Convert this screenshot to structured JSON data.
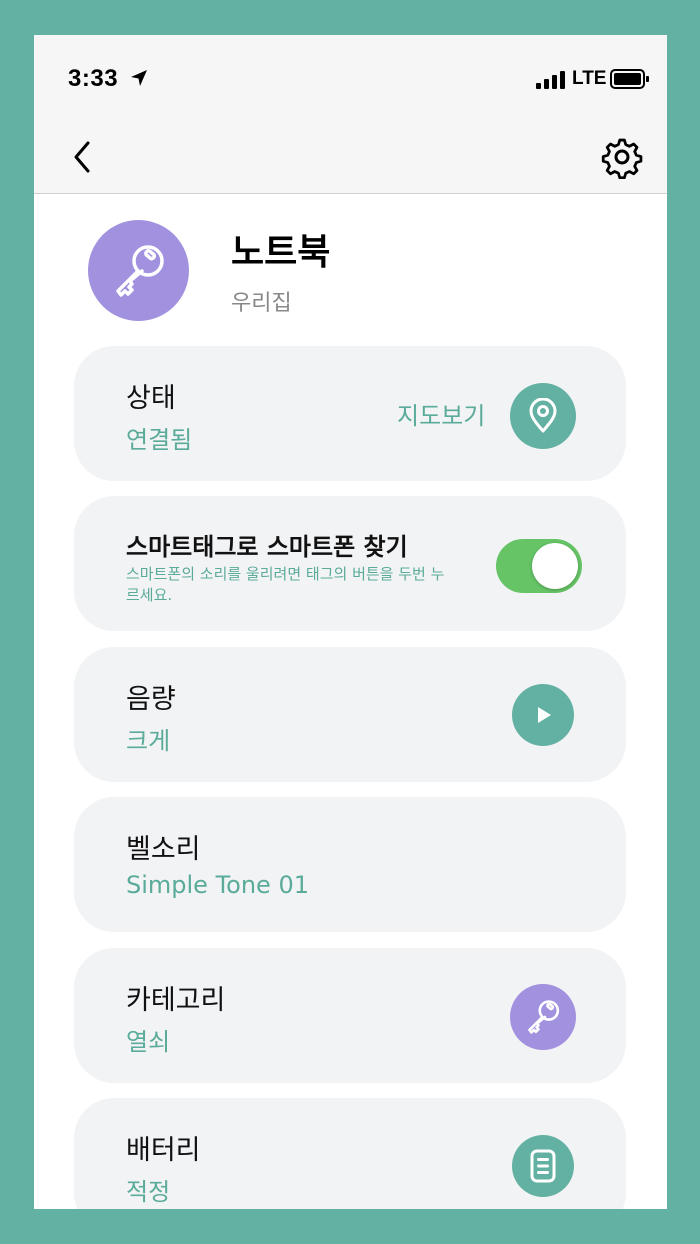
{
  "status": {
    "time": "3:33",
    "network": "LTE"
  },
  "device": {
    "name": "노트북",
    "location": "우리집"
  },
  "cards": {
    "state": {
      "title": "상태",
      "value": "연결됨",
      "map_label": "지도보기"
    },
    "find_phone": {
      "title": "스마트태그로 스마트폰 찾기",
      "description": "스마트폰의 소리를 울리려면 태그의 버튼을 두번 누르세요.",
      "enabled": true
    },
    "volume": {
      "title": "음량",
      "value": "크게"
    },
    "ringtone": {
      "title": "벨소리",
      "value": "Simple Tone 01"
    },
    "category": {
      "title": "카테고리",
      "value": "열쇠"
    },
    "battery": {
      "title": "배터리",
      "value": "적정"
    }
  },
  "colors": {
    "background": "#63b1a2",
    "accent_teal": "#63b1a2",
    "accent_purple": "#a191de",
    "toggle_on": "#66c466",
    "card_bg": "#f2f3f5"
  },
  "icons": {
    "device": "key-icon",
    "map": "location-pin-icon",
    "play": "play-icon",
    "category": "key-icon",
    "battery": "battery-icon"
  }
}
